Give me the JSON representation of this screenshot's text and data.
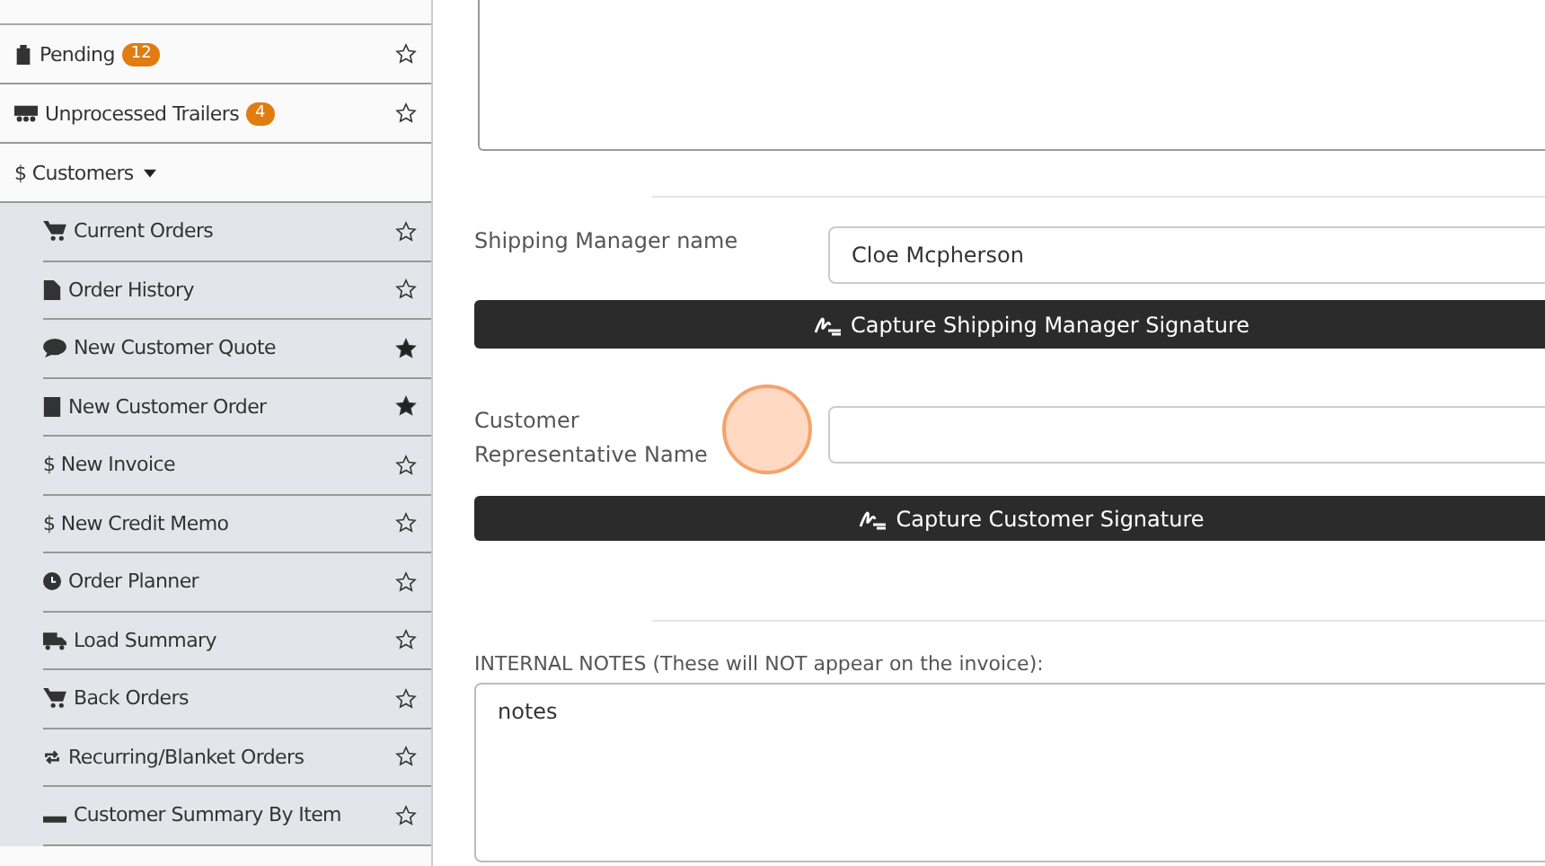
{
  "sidebar": {
    "items": [
      {
        "label": "Pending",
        "badge": "12",
        "favorite": false
      },
      {
        "label": "Unprocessed Trailers",
        "badge": "4",
        "favorite": false
      },
      {
        "label": "$ Customers",
        "expanded": true,
        "children": [
          {
            "label": "Current Orders",
            "favorite": false
          },
          {
            "label": "Order History",
            "favorite": false
          },
          {
            "label": "New Customer Quote",
            "favorite": true
          },
          {
            "label": "New Customer Order",
            "favorite": true
          },
          {
            "label": "$ New Invoice",
            "favorite": false
          },
          {
            "label": "$ New Credit Memo",
            "favorite": false
          },
          {
            "label": "Order Planner",
            "favorite": false
          },
          {
            "label": "Load Summary",
            "favorite": false
          },
          {
            "label": "Back Orders",
            "favorite": false
          },
          {
            "label": "Recurring/Blanket Orders",
            "favorite": false
          },
          {
            "label": "Customer Summary By Item",
            "favorite": false
          }
        ]
      }
    ]
  },
  "form": {
    "shipping_manager": {
      "label": "Shipping Manager name",
      "value": "Cloe Mcpherson",
      "button": "Capture Shipping Manager Signature"
    },
    "customer_rep": {
      "label": "Customer Representative Name",
      "button": "Capture Customer Signature"
    },
    "internal_notes": {
      "label": "INTERNAL NOTES (These will NOT appear on the invoice):",
      "value": "notes"
    }
  }
}
